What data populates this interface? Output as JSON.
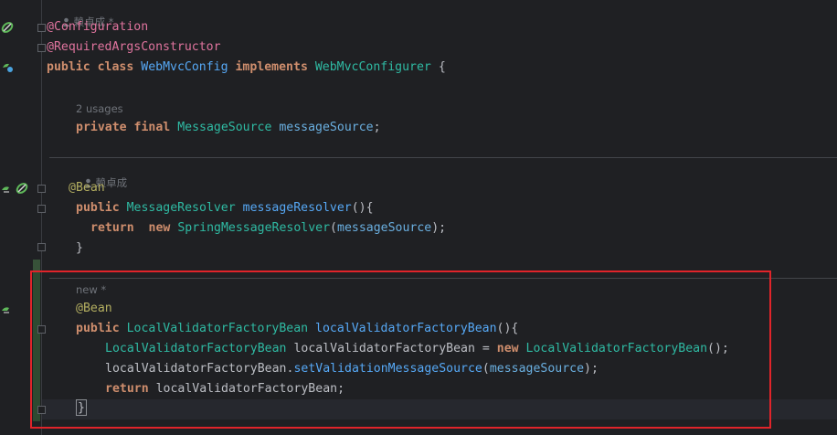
{
  "editor": {
    "hints": {
      "author_top": "赖卓成 *",
      "usages": "2 usages",
      "author_mid": "赖卓成",
      "new_hint": "new *"
    },
    "code": {
      "l1": {
        "a": "@Configuration"
      },
      "l2": {
        "a": "@RequiredArgsConstructor"
      },
      "l3": {
        "kw1": "public",
        "kw2": "class",
        "cls": "WebMvcConfig",
        "kw3": "implements",
        "iface": "WebMvcConfigurer",
        "tail": " {"
      },
      "l4": {
        "kw1": "private",
        "kw2": "final",
        "cls": "MessageSource",
        "fld": "messageSource",
        "tail": ";"
      },
      "l5": {
        "ann": "@Bean"
      },
      "l6": {
        "kw": "public",
        "cls": "MessageResolver",
        "mth": "messageResolver",
        "tail": "(){"
      },
      "l7": {
        "kw1": "return",
        "kw2": "new",
        "cls": "SpringMessageResolver",
        "p1": "(",
        "fld": "messageSource",
        "p2": ");"
      },
      "l8": {
        "tail": "}"
      },
      "l9": {
        "ann": "@Bean"
      },
      "l10": {
        "kw": "public",
        "cls": "LocalValidatorFactoryBean",
        "mth": "localValidatorFactoryBean",
        "tail": "(){"
      },
      "l11": {
        "cls": "LocalValidatorFactoryBean",
        "var": " localValidatorFactoryBean = ",
        "kw": "new",
        "cls2": "LocalValidatorFactoryBean",
        "tail": "();"
      },
      "l12": {
        "obj": "localValidatorFactoryBean.",
        "mth": "setValidationMessageSource",
        "p1": "(",
        "fld": "messageSource",
        "p2": ");"
      },
      "l13": {
        "kw": "return",
        "tail": " localValidatorFactoryBean;"
      },
      "l14": {
        "brace": "}"
      }
    }
  },
  "icons": {
    "g1": "bean-run-icon",
    "g2": "spring-config-icon",
    "g3": "bean-method-icon",
    "g4": "bean-method-icon"
  },
  "colors": {
    "keyword": "#cf8e6d",
    "annotation": "#b3ae60",
    "annotation_pink": "#e0749e",
    "class": "#2fbaa3",
    "field": "#6aafe0",
    "method": "#56a8f5",
    "highlight_box": "#e0242a"
  }
}
